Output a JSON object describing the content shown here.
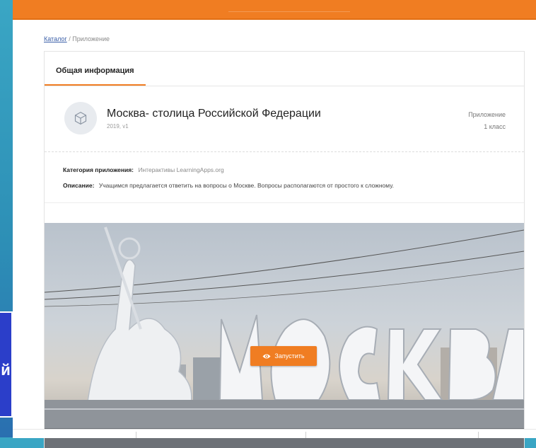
{
  "breadcrumb": {
    "catalog": "Каталог",
    "sep": "/",
    "current": "Приложение"
  },
  "tabs": [
    {
      "label": "Общая информация"
    }
  ],
  "app": {
    "title": "Москва- столица Российской Федерации",
    "subtitle": "2019, v1",
    "type": "Приложение",
    "grade": "1 класс",
    "icon": "cube-icon"
  },
  "info": {
    "category_label": "Категория приложения:",
    "category_value": "Интерактивы LearningApps.org",
    "description_label": "Описание:",
    "description_value": "Учащимся предлагается ответить на вопросы о Москве. Вопросы располагаются от простого к сложному."
  },
  "hero": {
    "sign_text": "МОСКВА"
  },
  "launch_button": {
    "label": "Запустить",
    "icon": "eye-icon"
  },
  "side": {
    "glyph": "й"
  },
  "colors": {
    "accent": "#f07d22",
    "link": "#3b5fa8",
    "background": "#3aa6c4"
  }
}
